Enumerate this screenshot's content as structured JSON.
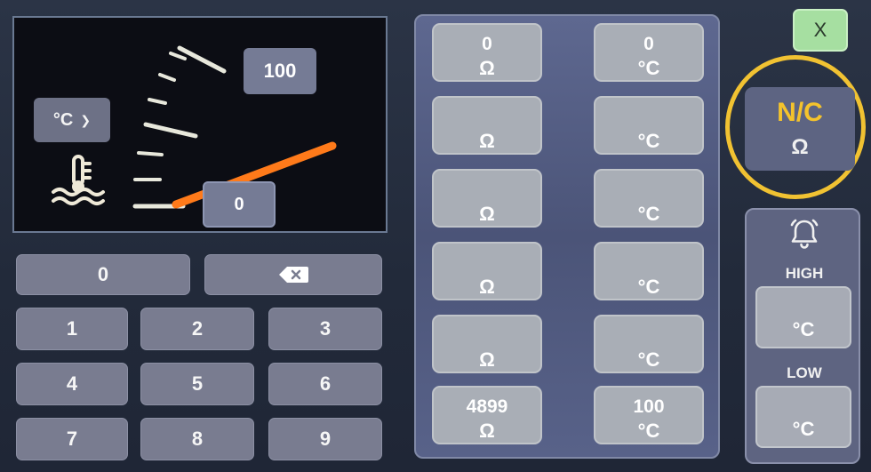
{
  "gauge": {
    "unit_selector": "°C",
    "max_value": "100",
    "min_value": "0",
    "needle_fraction": 0.0,
    "icon": "coolant-temperature-icon"
  },
  "keypad": {
    "display": "0",
    "backspace_icon": "backspace-icon",
    "keys": [
      "1",
      "2",
      "3",
      "4",
      "5",
      "6",
      "7",
      "8",
      "9"
    ]
  },
  "readings": {
    "rows": [
      {
        "ohm": "0",
        "ohm_unit": "Ω",
        "temp": "0",
        "temp_unit": "°C"
      },
      {
        "ohm": "",
        "ohm_unit": "Ω",
        "temp": "",
        "temp_unit": "°C"
      },
      {
        "ohm": "",
        "ohm_unit": "Ω",
        "temp": "",
        "temp_unit": "°C"
      },
      {
        "ohm": "",
        "ohm_unit": "Ω",
        "temp": "",
        "temp_unit": "°C"
      },
      {
        "ohm": "",
        "ohm_unit": "Ω",
        "temp": "",
        "temp_unit": "°C"
      },
      {
        "ohm": "4899",
        "ohm_unit": "Ω",
        "temp": "100",
        "temp_unit": "°C"
      }
    ]
  },
  "close_label": "X",
  "resistance": {
    "value": "N/C",
    "unit": "Ω"
  },
  "alarm": {
    "icon": "bell-icon",
    "high_label": "HIGH",
    "high_unit": "°C",
    "low_label": "LOW",
    "low_unit": "°C"
  },
  "colors": {
    "accent": "#f1c232",
    "needle": "#ff7a1a",
    "close": "#a6dfa1"
  }
}
